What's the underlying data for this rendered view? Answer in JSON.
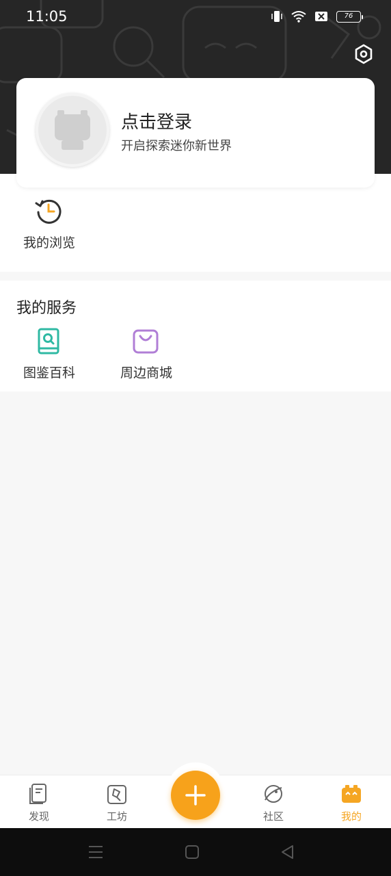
{
  "status_bar": {
    "time": "11:05",
    "battery": "76",
    "icons": [
      "vibrate-icon",
      "wifi-icon",
      "sim-off-icon",
      "battery-icon"
    ]
  },
  "header": {
    "settings_icon": "settings-hex-icon",
    "background_color": "#262626"
  },
  "profile": {
    "title": "点击登录",
    "subtitle": "开启探索迷你新世界"
  },
  "history": {
    "label": "我的浏览",
    "icon": "history-clock-icon"
  },
  "services": {
    "title": "我的服务",
    "items": [
      {
        "label": "图鉴百科",
        "icon": "encyclopedia-book-icon",
        "color": "#2fb9a3"
      },
      {
        "label": "周边商城",
        "icon": "shopping-bag-icon",
        "color": "#b07ed6"
      }
    ]
  },
  "bottom_nav": {
    "items": [
      {
        "label": "发现",
        "icon": "discover-icon",
        "active": false
      },
      {
        "label": "工坊",
        "icon": "workshop-icon",
        "active": false
      },
      {
        "label": "社区",
        "icon": "community-planet-icon",
        "active": false
      },
      {
        "label": "我的",
        "icon": "mine-icon",
        "active": true
      }
    ],
    "fab_icon": "plus-icon",
    "accent": "#f7a21b"
  },
  "system_nav": [
    "menu-icon",
    "home-icon",
    "back-icon"
  ]
}
